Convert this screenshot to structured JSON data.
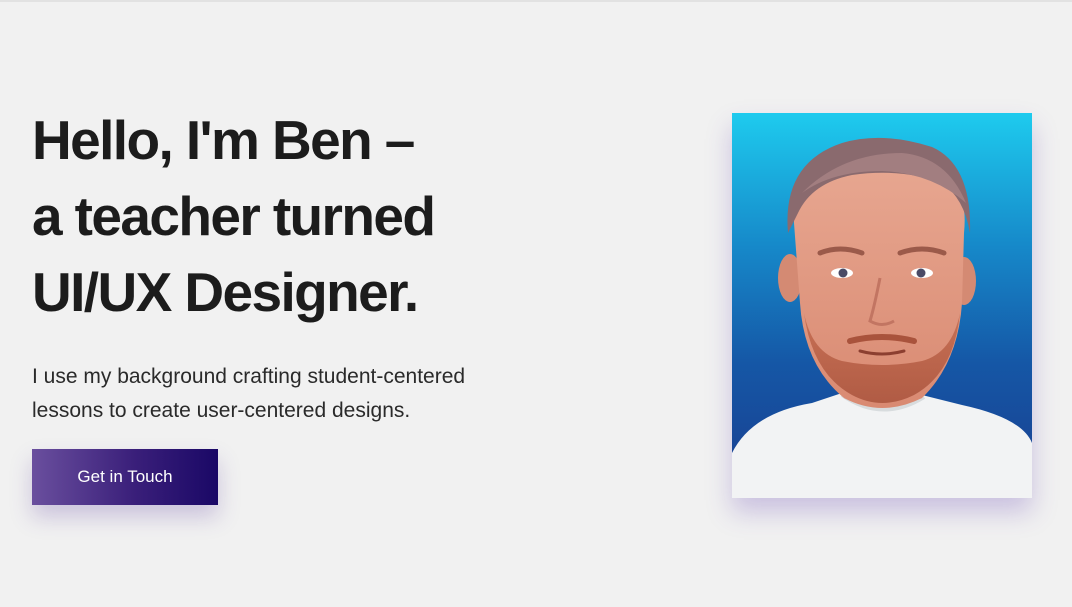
{
  "hero": {
    "headline": {
      "line1": "Hello, I'm Ben –",
      "line2": "a teacher turned",
      "line3": "UI/UX Designer."
    },
    "subtext": {
      "line1": "I use my background crafting student-centered",
      "line2": "lessons to create user-centered designs."
    },
    "cta_label": "Get in Touch",
    "portrait_icon": "profile-photo"
  },
  "colors": {
    "background": "#f1f1f1",
    "text": "#1c1c1c",
    "cta_gradient_start": "#6a4f9e",
    "cta_gradient_end": "#1a0866",
    "portrait_bg_top": "#1ecbee",
    "portrait_bg_bottom": "#1a3d8e"
  }
}
